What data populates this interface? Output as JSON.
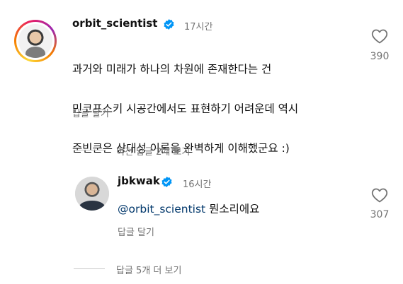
{
  "comment": {
    "username": "orbit_scientist",
    "time": "17시간",
    "text_line1": "과거와 미래가 하나의 차원에 존재한다는 건",
    "text_line2": "민코프스키 시공간에서도 표현하기 어려운데 역시",
    "text_line3": "준빈쿤은 상대성 이론을 완벽하게 이해했군요 :)",
    "reply_action": "답글 달기",
    "likes": "390",
    "like_icon": "heart-outline-icon",
    "verified_icon": "verified-badge-icon"
  },
  "view_previous": "이전 답글 2개 보기",
  "reply": {
    "username": "jbkwak",
    "time": "16시간",
    "mention": "@orbit_scientist",
    "text": "뭔소리에요",
    "reply_action": "답글 달기",
    "likes": "307",
    "like_icon": "heart-outline-icon",
    "verified_icon": "verified-badge-icon"
  },
  "view_more": "답글 5개 더 보기",
  "colors": {
    "verified": "#0095f6",
    "mention": "#00376b",
    "secondary_text": "#737373"
  }
}
